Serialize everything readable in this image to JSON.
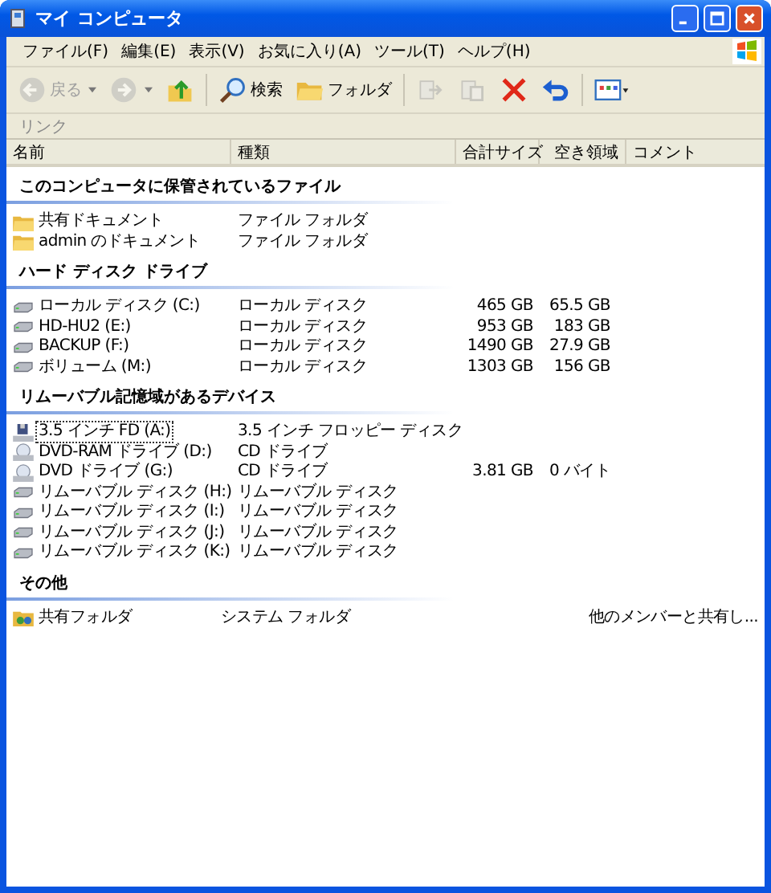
{
  "window": {
    "title": "マイ コンピュータ"
  },
  "menu": [
    "ファイル(F)",
    "編集(E)",
    "表示(V)",
    "お気に入り(A)",
    "ツール(T)",
    "ヘルプ(H)"
  ],
  "toolbar": [
    {
      "kind": "back",
      "label": "戻る",
      "disabled": true
    },
    {
      "kind": "forward",
      "disabled": true
    },
    {
      "kind": "up",
      "disabled": false
    },
    {
      "kind": "search",
      "label": "検索",
      "disabled": false
    },
    {
      "kind": "folders",
      "label": "フォルダ",
      "disabled": false
    },
    {
      "kind": "move",
      "disabled": true
    },
    {
      "kind": "copy",
      "disabled": true
    },
    {
      "kind": "delete",
      "disabled": false
    },
    {
      "kind": "undo",
      "disabled": false
    },
    {
      "kind": "views",
      "disabled": false
    }
  ],
  "links_bar": {
    "label": "リンク"
  },
  "columns": [
    "名前",
    "種類",
    "合計サイズ",
    "空き領域",
    "コメント"
  ],
  "groups": [
    {
      "title": "このコンピュータに保管されているファイル",
      "items": [
        {
          "kind": "folder",
          "name": "共有ドキュメント",
          "type": "ファイル フォルダ",
          "focused": false
        },
        {
          "kind": "folder",
          "name": "admin のドキュメント",
          "type": "ファイル フォルダ",
          "focused": false
        }
      ]
    },
    {
      "title": "ハード ディスク ドライブ",
      "items": [
        {
          "kind": "disk",
          "name": "ローカル ディスク (C:)",
          "type": "ローカル ディスク",
          "total": "465 GB",
          "free": "65.5 GB",
          "focused": false
        },
        {
          "kind": "disk",
          "name": "HD-HU2 (E:)",
          "type": "ローカル ディスク",
          "total": "953 GB",
          "free": "183 GB",
          "focused": false
        },
        {
          "kind": "disk",
          "name": "BACKUP (F:)",
          "type": "ローカル ディスク",
          "total": "1490 GB",
          "free": "27.9 GB",
          "focused": false
        },
        {
          "kind": "disk",
          "name": "ボリューム (M:)",
          "type": "ローカル ディスク",
          "total": "1303 GB",
          "free": "156 GB",
          "focused": false
        }
      ]
    },
    {
      "title": "リムーバブル記憶域があるデバイス",
      "items": [
        {
          "kind": "floppy",
          "name": "3.5 インチ FD (A:)",
          "type": "3.5 インチ フロッピー ディスク",
          "focused": true
        },
        {
          "kind": "cd",
          "name": "DVD-RAM ドライブ (D:)",
          "type": "CD ドライブ",
          "focused": false
        },
        {
          "kind": "cd",
          "name": "DVD ドライブ (G:)",
          "type": "CD ドライブ",
          "total": "3.81 GB",
          "free": "0 バイト",
          "focused": false
        },
        {
          "kind": "disk",
          "name": "リムーバブル ディスク (H:)",
          "type": "リムーバブル ディスク",
          "focused": false
        },
        {
          "kind": "disk",
          "name": "リムーバブル ディスク (I:)",
          "type": "リムーバブル ディスク",
          "focused": false
        },
        {
          "kind": "disk",
          "name": "リムーバブル ディスク (J:)",
          "type": "リムーバブル ディスク",
          "focused": false
        },
        {
          "kind": "disk",
          "name": "リムーバブル ディスク (K:)",
          "type": "リムーバブル ディスク",
          "focused": false
        }
      ]
    },
    {
      "title": "その他",
      "items": [
        {
          "kind": "shared",
          "name": "共有フォルダ",
          "type": "システム フォルダ",
          "comment": "他のメンバーと共有し...",
          "focused": false
        }
      ]
    }
  ]
}
